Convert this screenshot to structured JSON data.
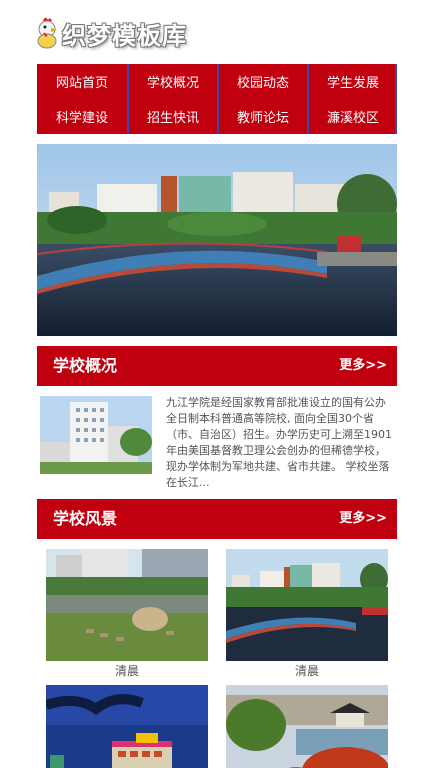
{
  "site": {
    "logo_text": "织梦模板库"
  },
  "nav": [
    {
      "label": "网站首页"
    },
    {
      "label": "学校概况"
    },
    {
      "label": "校园动态"
    },
    {
      "label": "学生发展"
    },
    {
      "label": "科学建设"
    },
    {
      "label": "招生快讯"
    },
    {
      "label": "教师论坛"
    },
    {
      "label": "濂溪校区"
    }
  ],
  "overview": {
    "title": "学校概况",
    "more": "更多>>",
    "text": "九江学院是经国家教育部批准设立的国有公办全日制本科普通高等院校, 面向全国30个省（市、自治区）招生。办学历史可上溯至1901年由美国基督教卫理公会创办的但稀德学校，现办学体制为军地共建、省市共建。 学校坐落在长江..."
  },
  "scenery": {
    "title": "学校风景",
    "more": "更多>>",
    "items": [
      {
        "caption": "清晨"
      },
      {
        "caption": "清晨"
      },
      {
        "caption": ""
      },
      {
        "caption": ""
      }
    ]
  },
  "colors": {
    "brand_red": "#c0000f",
    "nav_divider": "#3b46b3"
  }
}
